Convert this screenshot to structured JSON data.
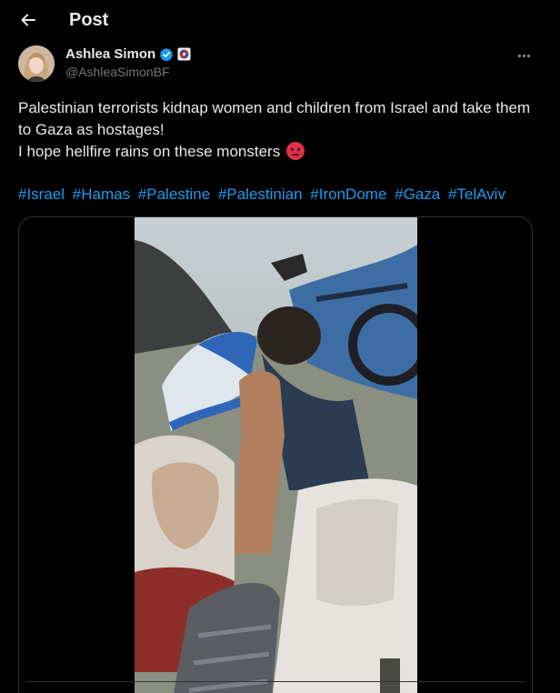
{
  "header": {
    "title": "Post"
  },
  "author": {
    "name": "Ashlea Simon",
    "handle": "@AshleaSimonBF"
  },
  "post": {
    "line1": "Palestinian terrorists kidnap women and children from Israel and take them to Gaza as hostages!",
    "line2": "I hope hellfire rains on these monsters",
    "hashtags": [
      "#Israel",
      "#Hamas",
      "#Palestine",
      "#Palestinian",
      "#IronDome",
      "#Gaza",
      "#TelAviv"
    ]
  },
  "colors": {
    "accent": "#1d9bf0",
    "verified": "#1d9bf0",
    "background": "#000000",
    "muted": "#71767b"
  },
  "icons": {
    "back": "arrow-left-icon",
    "verified": "verified-badge-icon",
    "affiliation": "affiliate-badge-icon",
    "more": "more-horizontal-icon"
  }
}
